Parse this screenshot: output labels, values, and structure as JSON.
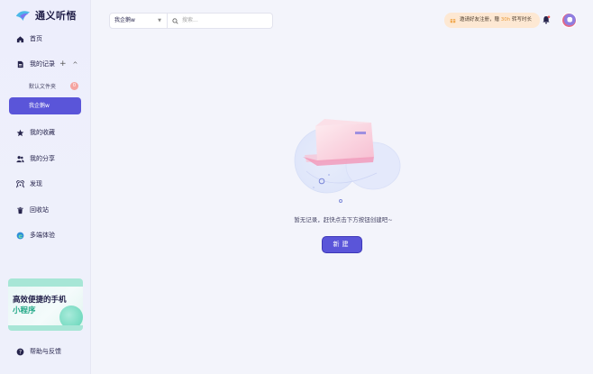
{
  "app": {
    "name": "通义听悟"
  },
  "sidebar": {
    "home": "首页",
    "my_records": "我的记录",
    "add_symbol": "+",
    "collapse_symbol": "^",
    "default_folder": "默认文件夹",
    "default_folder_count": "0",
    "active_folder": "我企鹅w",
    "favorites": "我的收藏",
    "shares": "我的分享",
    "discover": "发现",
    "trash": "回收站",
    "multi_device": "多端体验",
    "help": "帮助与反馈",
    "promo": {
      "line1": "高效便捷的手机",
      "line2": "小程序"
    }
  },
  "topbar": {
    "folder_select": "我企鹅w",
    "search_placeholder": "搜索...",
    "invite": {
      "prefix": "邀请好友注册，赠 ",
      "highlight": "30h",
      "suffix": " 转写时长"
    }
  },
  "empty_state": {
    "message": "暂无记录，赶快点击下方按钮创建吧~",
    "new_button": "新建"
  },
  "colors": {
    "accent": "#5a55d9",
    "promo_green": "#22a887",
    "invite_bg": "#fde8d3"
  }
}
